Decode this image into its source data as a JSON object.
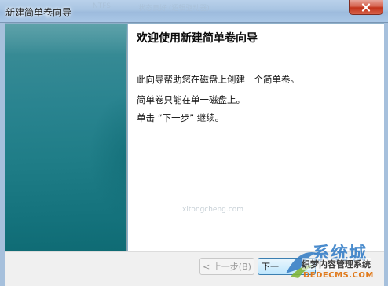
{
  "window": {
    "title": "新建简单卷向导",
    "close_glyph": "close-icon"
  },
  "wizard": {
    "heading": "欢迎使用新建简单卷向导",
    "paragraphs": [
      "此向导帮助您在磁盘上创建一个简单卷。",
      "简单卷只能在单一磁盘上。",
      "单击 “下一步” 继续。"
    ]
  },
  "buttons": {
    "back_label": "< 上一步(B)",
    "next_label": "下一"
  },
  "watermark": {
    "brand": "系统城",
    "cms": "织梦内容管理系统",
    "url": "DEDECMS.COM",
    "site": "xitongcheng.com"
  },
  "colors": {
    "banner_teal": "#1f7d87",
    "titlebar": "#a8c4e2",
    "close_red": "#c2331a"
  }
}
